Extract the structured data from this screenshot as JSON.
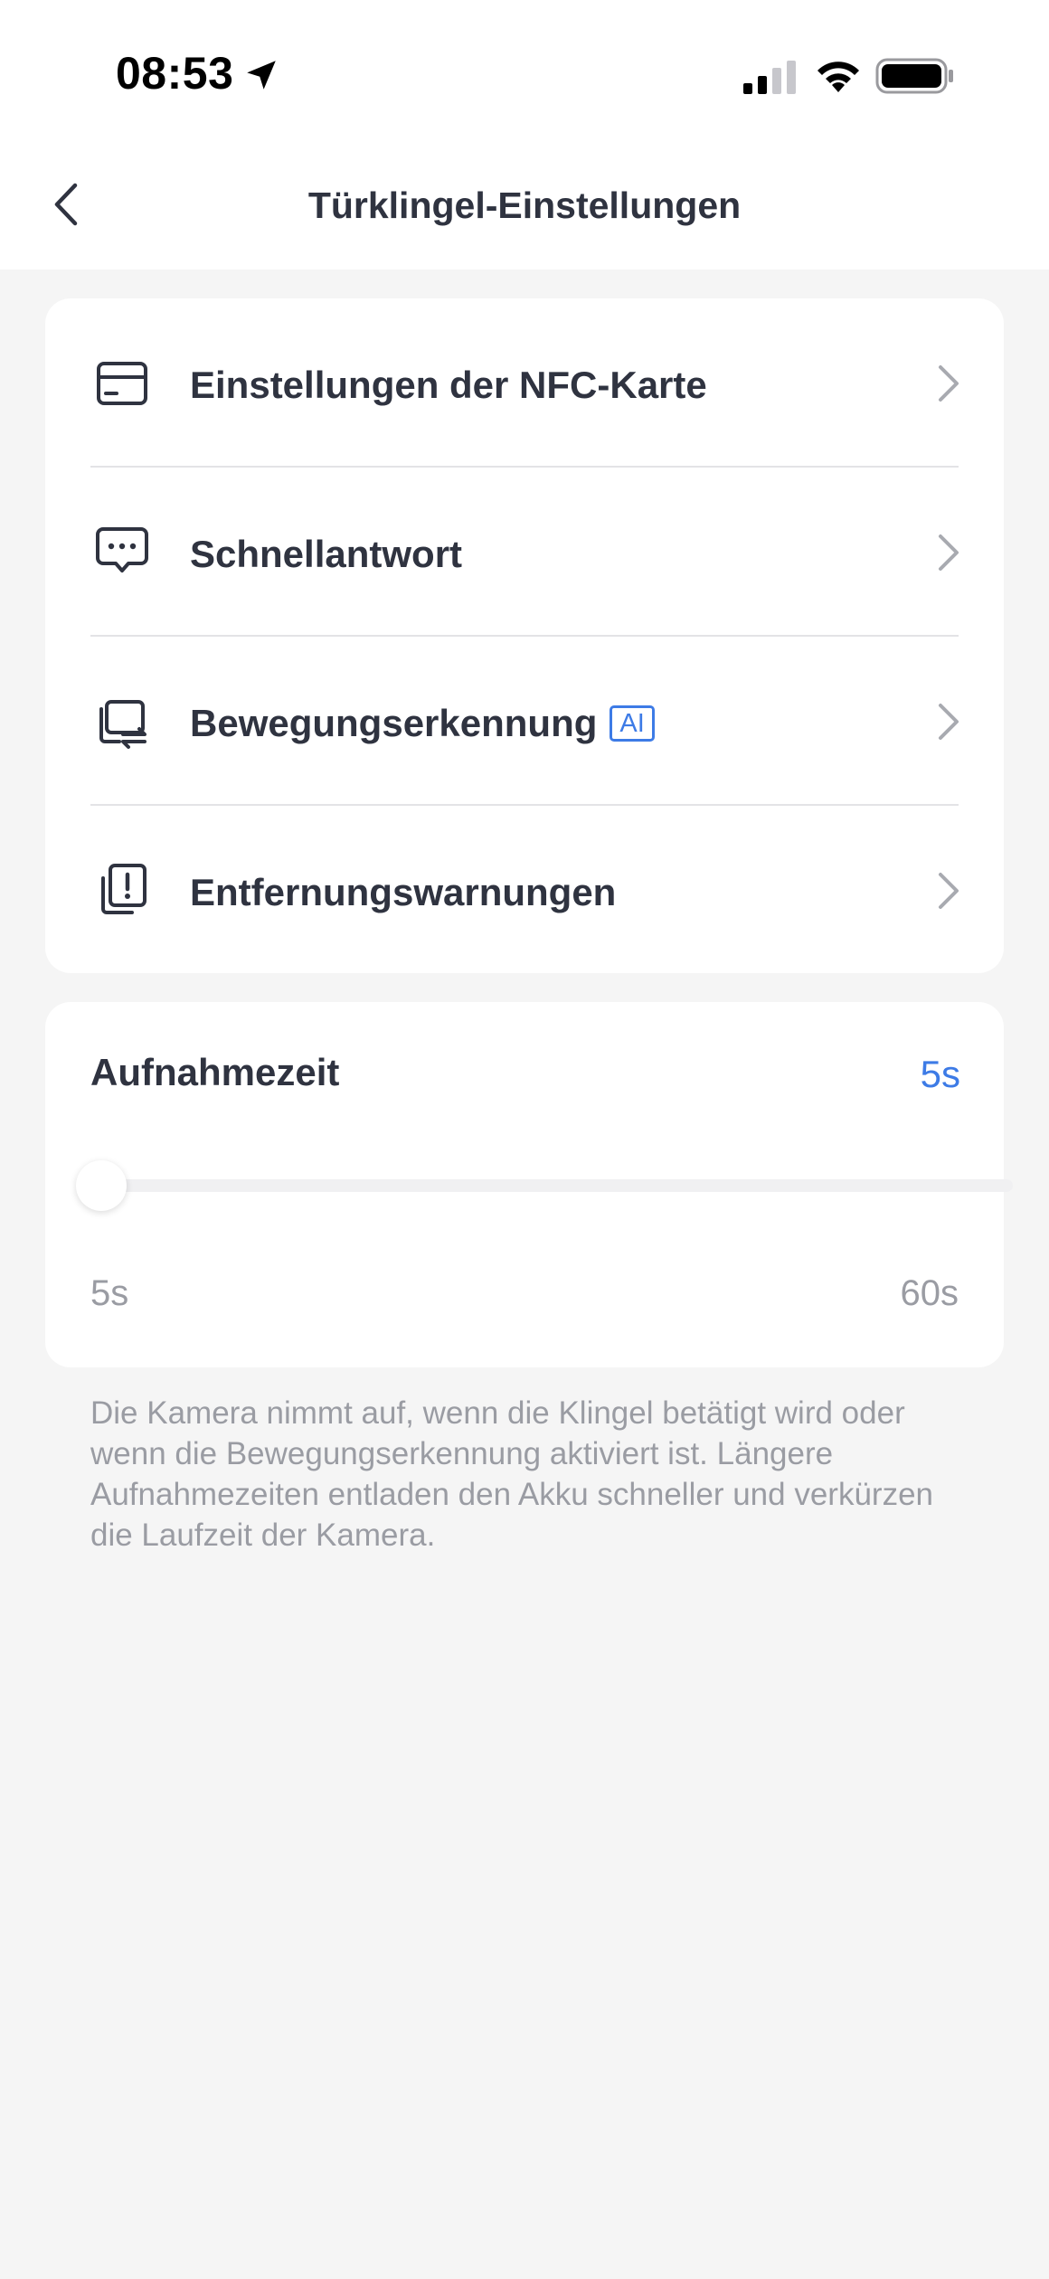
{
  "status_bar": {
    "time": "08:53"
  },
  "header": {
    "title": "Türklingel-Einstellungen"
  },
  "menu": {
    "items": [
      {
        "label": "Einstellungen der NFC-Karte",
        "icon": "nfc-card-icon"
      },
      {
        "label": "Schnellantwort",
        "icon": "quick-reply-icon"
      },
      {
        "label": "Bewegungserkennung",
        "badge": "AI",
        "icon": "motion-detection-icon"
      },
      {
        "label": "Entfernungswarnungen",
        "icon": "removal-warning-icon"
      }
    ]
  },
  "recording": {
    "title": "Aufnahmezeit",
    "value": "5s",
    "min_label": "5s",
    "max_label": "60s",
    "slider_fraction": 0
  },
  "description": "Die Kamera nimmt auf, wenn die Klingel betätigt wird oder wenn die Bewegungserkennung aktiviert ist. Längere Aufnahmezeiten entladen den Akku schneller und verkürzen die Laufzeit der Kamera.",
  "colors": {
    "accent": "#3d7be6",
    "background": "#f5f5f5",
    "card": "#ffffff",
    "text": "#2f3340",
    "muted": "#9a9ca3"
  }
}
